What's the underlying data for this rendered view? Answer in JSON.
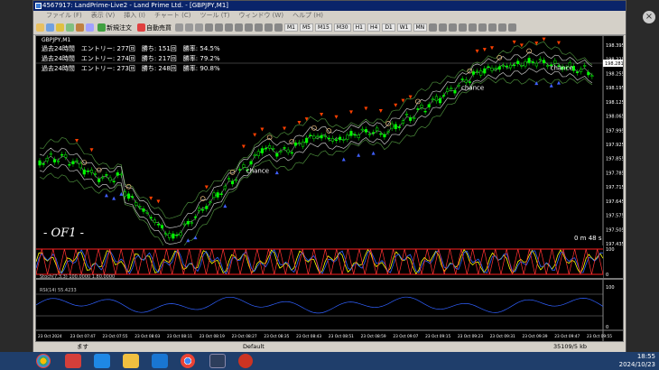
{
  "window": {
    "title": "4567917: LandPrime-Live2 - Land Prime Ltd. - [GBPJPY,M1]"
  },
  "menu": [
    "ファイル (F)",
    "表示 (V)",
    "挿入 (I)",
    "チャート (C)",
    "ツール (T)",
    "ウィンドウ (W)",
    "ヘルプ (H)"
  ],
  "toolbar": {
    "new_order": "新規注文",
    "autotrade": "自動売買",
    "timeframes": [
      "M1",
      "M5",
      "M15",
      "M30",
      "H1",
      "H4",
      "D1",
      "W1",
      "MN"
    ]
  },
  "chart": {
    "symbol": "GBPJPY,M1",
    "stats": [
      "過去24時間　エントリー: 277回　勝ち: 151回　勝率: 54.5%",
      "過去24時間　エントリー: 274回　勝ち: 217回　勝率: 79.2%",
      "過去24時間　エントリー: 273回　勝ち: 248回　勝率: 90.8%"
    ],
    "watermark": "- OF1 -",
    "timer": "0 m 48 s",
    "chance_labels": [
      "chance",
      "chance",
      "chance"
    ],
    "price_labels": [
      "198.395",
      "198.335",
      "198.255",
      "198.195",
      "198.125",
      "198.065",
      "197.995",
      "197.925",
      "197.855",
      "197.785",
      "197.715",
      "197.645",
      "197.575",
      "197.505",
      "197.435"
    ],
    "current_price": "198.281",
    "stoch_label": "Stoch(7,3,3) 100.0000 1.80.0000",
    "stoch_levels": [
      "100",
      "0"
    ],
    "rsi_label": "RSI(14) 55.4233",
    "rsi_levels": [
      "100",
      "0"
    ],
    "time_labels": [
      "23 Oct 2024",
      "23 Oct 07:47",
      "23 Oct 07:55",
      "23 Oct 08:03",
      "23 Oct 08:11",
      "23 Oct 08:19",
      "23 Oct 08:27",
      "23 Oct 08:35",
      "23 Oct 08:43",
      "23 Oct 08:51",
      "23 Oct 08:59",
      "23 Oct 09:07",
      "23 Oct 09:15",
      "23 Oct 09:23",
      "23 Oct 09:31",
      "23 Oct 09:39",
      "23 Oct 09:47",
      "23 Oct 09:55"
    ]
  },
  "status": {
    "profile": "Default",
    "left": "ます",
    "traffic": "35109/5 kb"
  },
  "taskbar": {
    "time": "18:55",
    "date": "2024/10/23"
  },
  "colors": {
    "candle_up": "#00ff00",
    "arrow_sell": "#ff4000",
    "arrow_buy": "#4060ff",
    "band": "#c0c0c0",
    "ma": "#ffff00"
  }
}
